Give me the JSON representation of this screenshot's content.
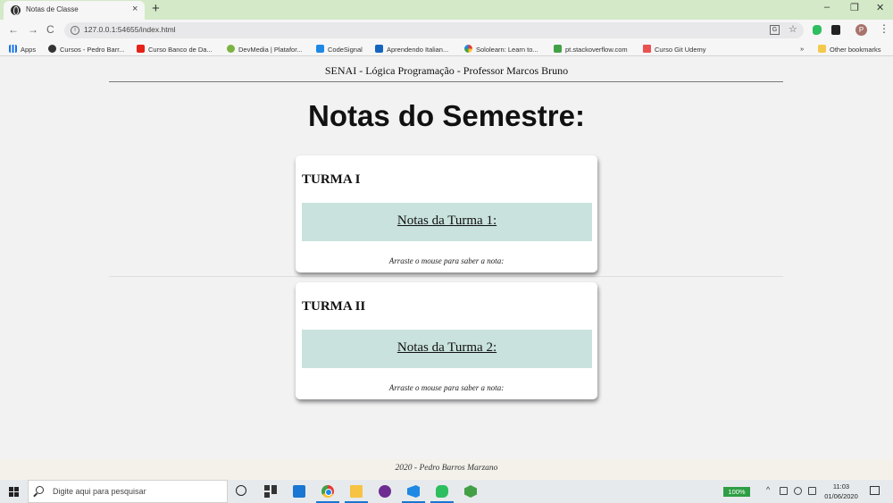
{
  "browser": {
    "tab": {
      "title": "Notas de Classe",
      "close": "×"
    },
    "new_tab": "+",
    "window_controls": {
      "minimize": "–",
      "maximize": "❐",
      "close": "✕"
    },
    "nav": {
      "back": "←",
      "forward": "→",
      "reload": "C"
    },
    "address": {
      "info": "i",
      "url": "127.0.0.1:54655/index.html"
    },
    "translate": "G",
    "star": "☆",
    "profile": "P",
    "menu": "⋮",
    "bookmarks": [
      {
        "label": "Apps",
        "icon": "apps-grid-icon"
      },
      {
        "label": "Cursos - Pedro Barr...",
        "icon": "github-icon"
      },
      {
        "label": "Curso Banco de Da...",
        "icon": "youtube-icon"
      },
      {
        "label": "DevMedia | Platafor...",
        "icon": "devmedia-icon"
      },
      {
        "label": "CodeSignal",
        "icon": "codesignal-icon"
      },
      {
        "label": "Aprendendo Italian...",
        "icon": "bookmark-icon"
      },
      {
        "label": "Sololearn: Learn to...",
        "icon": "sololearn-icon"
      },
      {
        "label": "pt.stackoverflow.com",
        "icon": "stackoverflow-icon"
      },
      {
        "label": "Curso Git Udemy",
        "icon": "udemy-icon"
      }
    ],
    "bookmarks_more": "»",
    "other_bookmarks": "Other bookmarks"
  },
  "page": {
    "header": "SENAI - Lógica Programação - Professor Marcos Bruno",
    "title": "Notas do Semestre:",
    "cards": [
      {
        "heading": "TURMA I",
        "link": "Notas da Turma 1:",
        "hint": "Arraste o mouse para saber a nota:"
      },
      {
        "heading": "TURMA II",
        "link": "Notas da Turma 2:",
        "hint": "Arraste o mouse para saber a nota:"
      }
    ],
    "footer": "2020 - Pedro Barros Marzano"
  },
  "taskbar": {
    "search_placeholder": "Digite aqui para pesquisar",
    "battery": "100%",
    "tray_arrow": "^",
    "time": "11:03",
    "date": "01/06/2020"
  },
  "colors": {
    "tabbar": "#d4e9c7",
    "card_highlight": "#c9e2dd",
    "page_bg": "#f2f2f3",
    "battery_badge": "#2e9e44"
  }
}
